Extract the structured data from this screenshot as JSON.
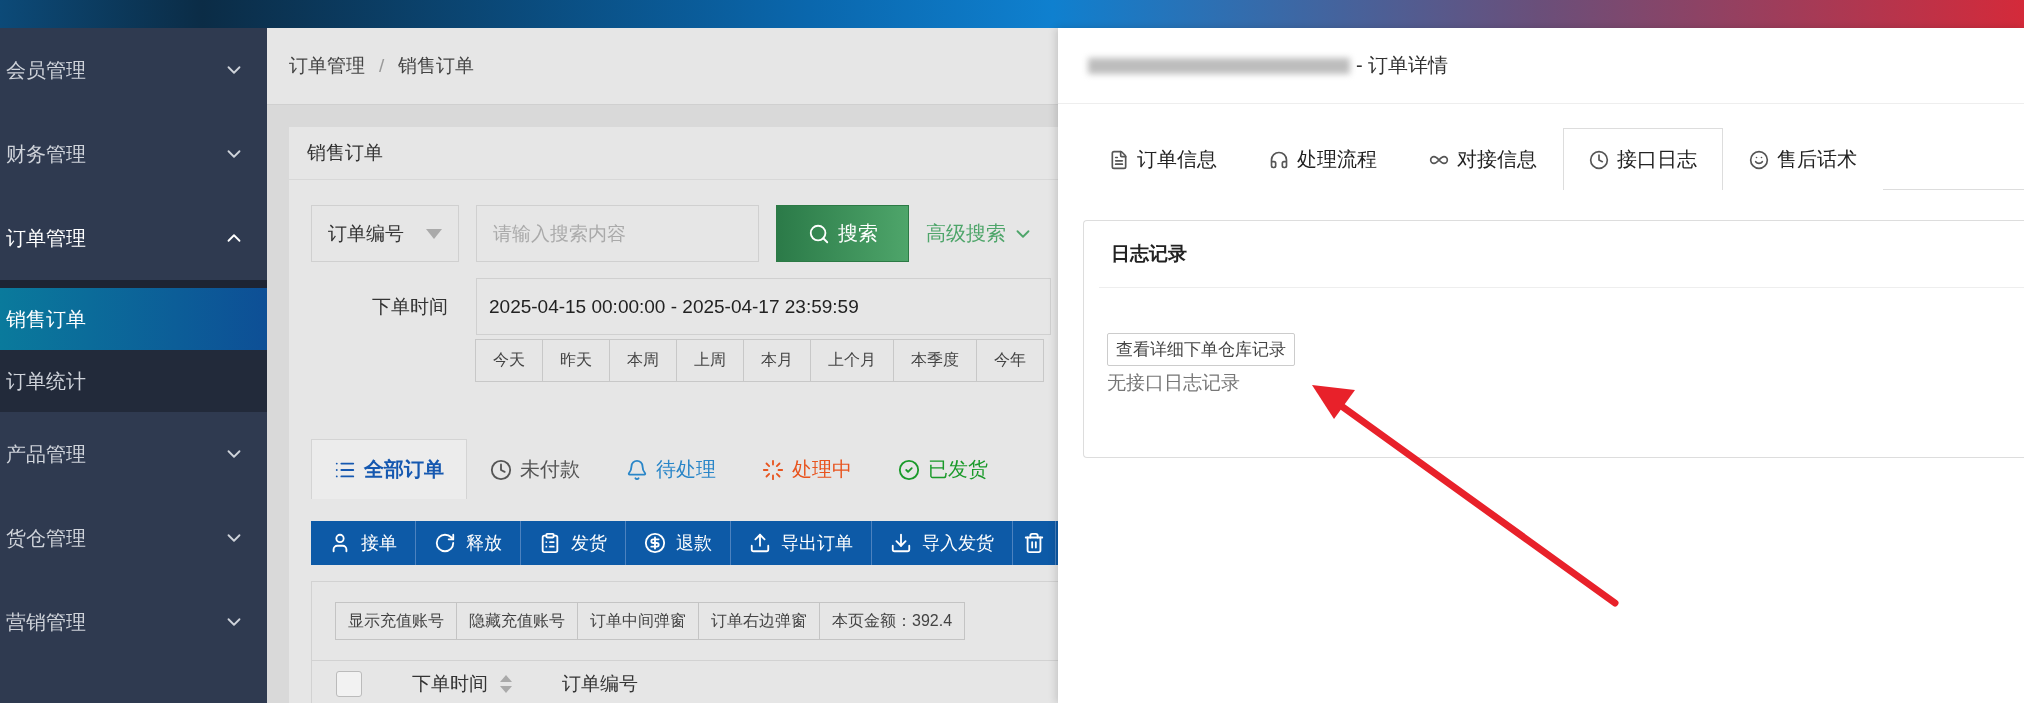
{
  "sidebar": {
    "items": [
      {
        "label": "会员管理",
        "expanded": false
      },
      {
        "label": "财务管理",
        "expanded": false
      },
      {
        "label": "订单管理",
        "expanded": true,
        "children": [
          {
            "label": "销售订单",
            "selected": true
          },
          {
            "label": "订单统计",
            "selected": false
          }
        ]
      },
      {
        "label": "产品管理",
        "expanded": false
      },
      {
        "label": "货仓管理",
        "expanded": false
      },
      {
        "label": "营销管理",
        "expanded": false
      }
    ]
  },
  "breadcrumb": {
    "items": [
      "订单管理",
      "销售订单"
    ],
    "separator": "/"
  },
  "order_card": {
    "title": "销售订单",
    "search": {
      "field_select": "订单编号",
      "placeholder": "请输入搜索内容",
      "button": "搜索",
      "advanced": "高级搜索"
    },
    "date_filter": {
      "label": "下单时间",
      "value": "2025-04-15 00:00:00 - 2025-04-17 23:59:59",
      "presets": [
        "今天",
        "昨天",
        "本周",
        "上周",
        "本月",
        "上个月",
        "本季度",
        "今年"
      ]
    },
    "status_tabs": [
      {
        "label": "全部订单",
        "kind": "list",
        "selected": true,
        "color": "#1558b0"
      },
      {
        "label": "未付款",
        "kind": "clock",
        "selected": false,
        "color": "#555555"
      },
      {
        "label": "待处理",
        "kind": "bell",
        "selected": false,
        "color": "#2a86c8"
      },
      {
        "label": "处理中",
        "kind": "loader",
        "selected": false,
        "color": "#e8541e"
      },
      {
        "label": "已发货",
        "kind": "check",
        "selected": false,
        "color": "#1a9a2a"
      }
    ],
    "actions": [
      {
        "label": "接单",
        "kind": "user"
      },
      {
        "label": "释放",
        "kind": "refresh"
      },
      {
        "label": "发货",
        "kind": "clipboard"
      },
      {
        "label": "退款",
        "kind": "money"
      },
      {
        "label": "导出订单",
        "kind": "export"
      },
      {
        "label": "导入发货",
        "kind": "import"
      },
      {
        "kind": "delete"
      }
    ],
    "options": [
      "显示充值账号",
      "隐藏充值账号",
      "订单中间弹窗",
      "订单右边弹窗",
      "本页金额：392.4"
    ],
    "select_all": {
      "checked": false
    },
    "columns": [
      {
        "label": "下单时间",
        "sortable": true
      },
      {
        "label": "订单编号",
        "sortable": false
      }
    ]
  },
  "detail_panel": {
    "title": "- 订单详情",
    "tabs": [
      {
        "label": "订单信息",
        "kind": "document",
        "selected": false
      },
      {
        "label": "处理流程",
        "kind": "headset",
        "selected": false
      },
      {
        "label": "对接信息",
        "kind": "link",
        "selected": false
      },
      {
        "label": "接口日志",
        "kind": "clock",
        "selected": true
      },
      {
        "label": "售后话术",
        "kind": "chat",
        "selected": false
      }
    ],
    "log_card": {
      "title": "日志记录",
      "button": "查看详细下单仓库记录",
      "empty_text": "无接口日志记录"
    }
  }
}
